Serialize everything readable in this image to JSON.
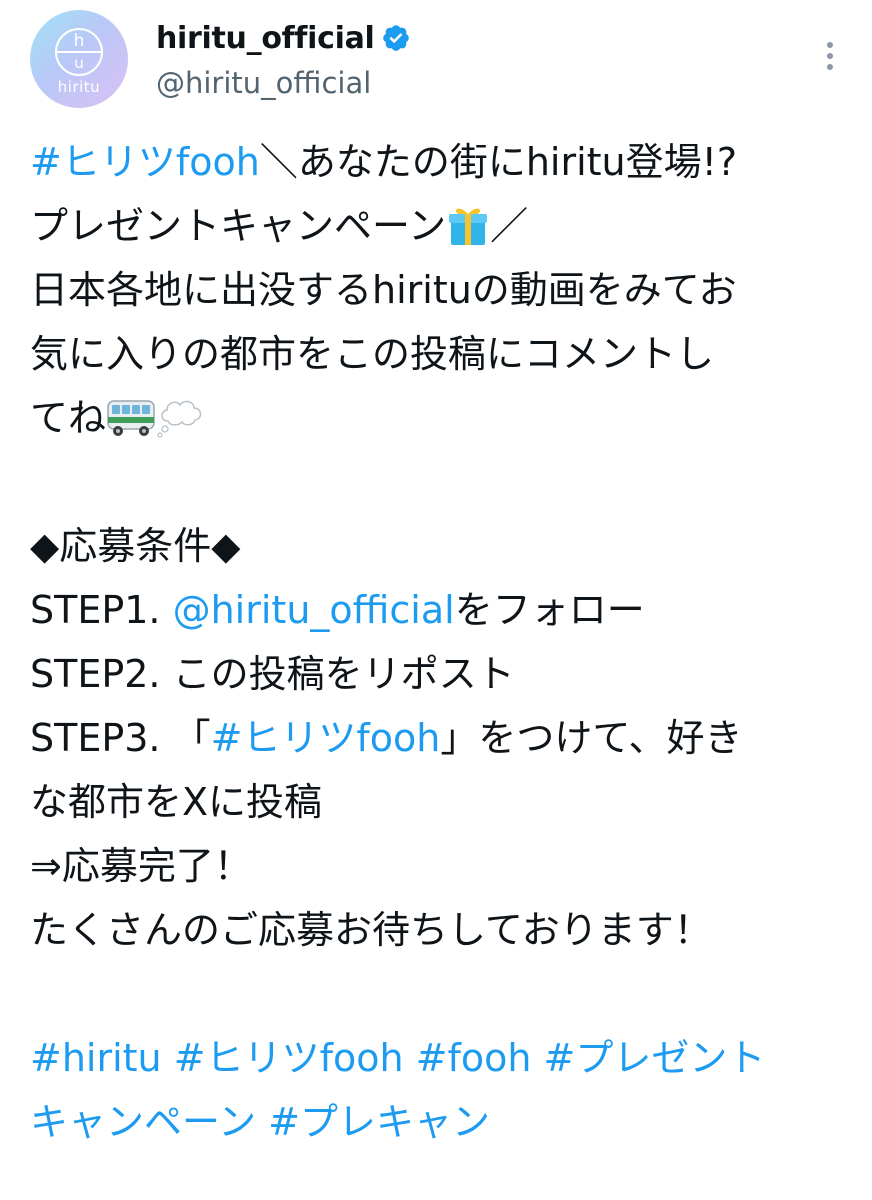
{
  "account": {
    "display_name": "hiritu_official",
    "handle": "@hiritu_official",
    "avatar_text": "hiritu",
    "avatar_mark_top": "h",
    "avatar_mark_bottom": "u"
  },
  "post": {
    "line1_hashtag": "#ヒリツfooh",
    "line1_rest": "＼あなたの街にhiritu登場!?",
    "line2": "プレゼントキャンペーン",
    "line2_tail": "／",
    "line3": "日本各地に出没するhirituの動画をみてお",
    "line4": "気に入りの都市をこの投稿にコメントし",
    "line5": "てね",
    "conditions_title": "◆応募条件◆",
    "step1_prefix": "STEP1. ",
    "step1_mention": "@hiritu_official",
    "step1_suffix": "をフォロー",
    "step2": "STEP2. この投稿をリポスト",
    "step3_prefix": "STEP3. 「",
    "step3_hashtag": "#ヒリツfooh",
    "step3_suffix": "」をつけて、好き",
    "step3_cont": "な都市をXに投稿",
    "complete": "⇒応募完了！",
    "closing": "たくさんのご応募お待ちしております！",
    "hashtags_line1": "#hiritu #ヒリツfooh #fooh  #プレゼント",
    "hashtags_line2": "キャンペーン #プレキャン"
  },
  "icons": {
    "verified": "verified-badge-icon",
    "more": "more-options-icon",
    "gift": "gift-emoji",
    "bus": "bus-emoji",
    "thought": "thought-balloon-emoji"
  },
  "colors": {
    "link": "#1d9bf0",
    "text": "#0f1419",
    "secondary": "#536471",
    "verified": "#1d9bf0"
  }
}
